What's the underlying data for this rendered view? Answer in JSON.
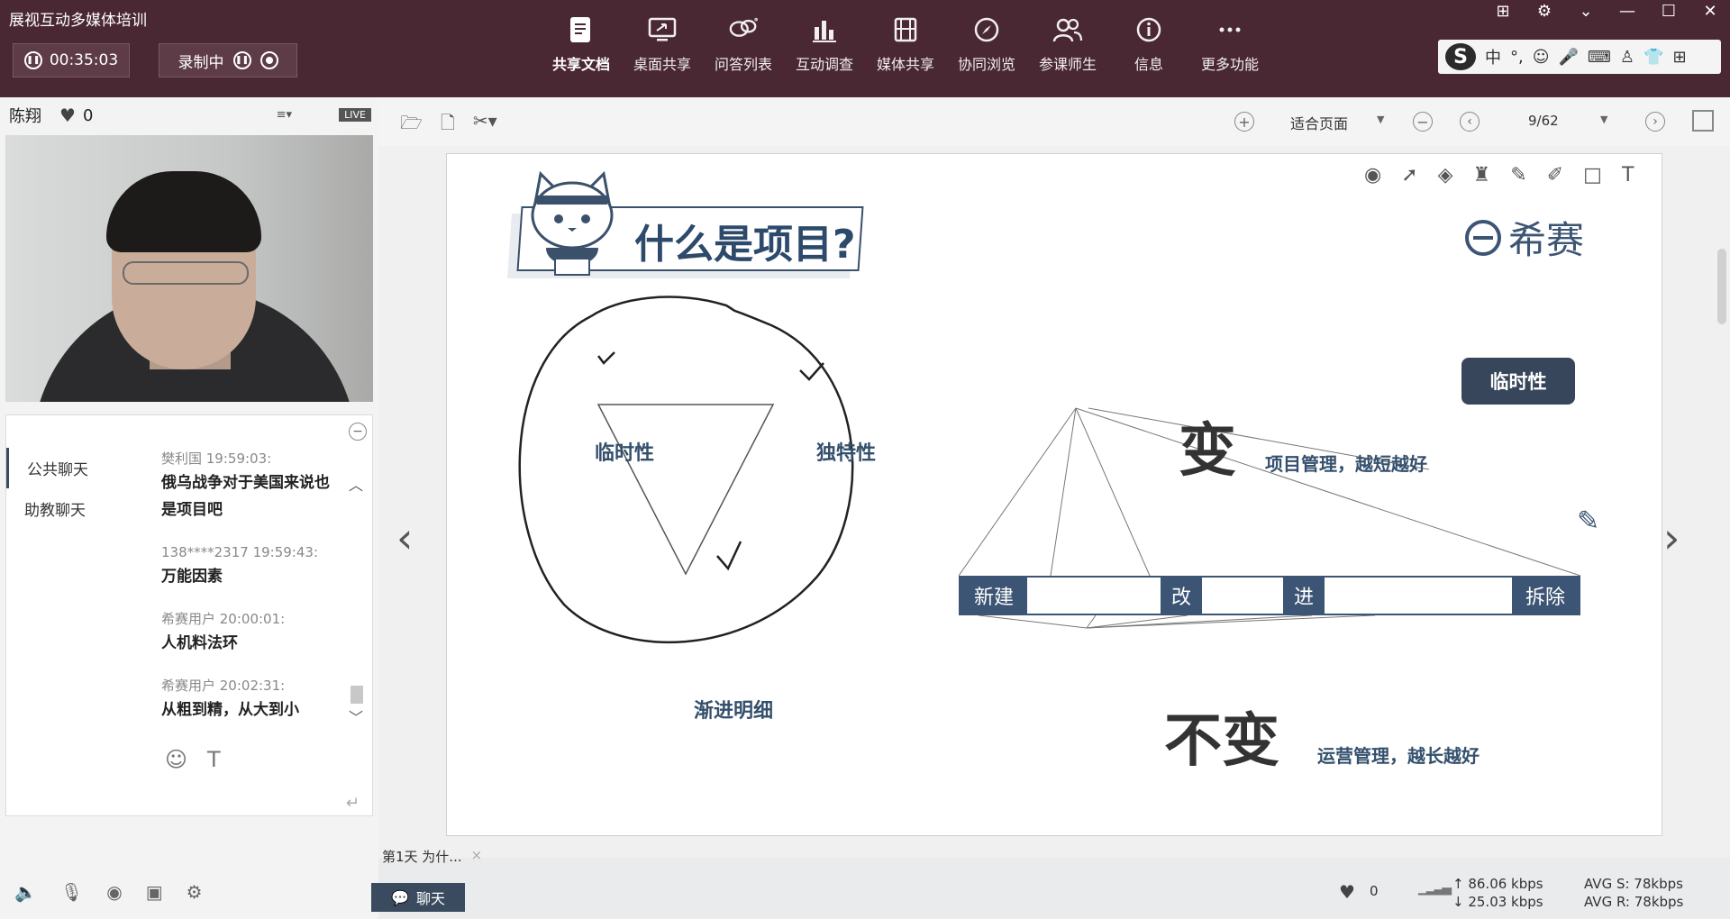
{
  "app": {
    "title": "展视互动多媒体培训",
    "timer": "00:35:03",
    "recording_label": "录制中"
  },
  "toolbar": [
    {
      "label": "共享文档",
      "icon": "doc-share-icon",
      "active": true
    },
    {
      "label": "桌面共享",
      "icon": "desktop-share-icon"
    },
    {
      "label": "问答列表",
      "icon": "qa-list-icon"
    },
    {
      "label": "互动调查",
      "icon": "survey-chart-icon"
    },
    {
      "label": "媒体共享",
      "icon": "media-film-icon"
    },
    {
      "label": "协同浏览",
      "icon": "compass-icon"
    },
    {
      "label": "参课师生",
      "icon": "users-icon"
    },
    {
      "label": "信息",
      "icon": "info-icon"
    },
    {
      "label": "更多功能",
      "icon": "more-dots-icon"
    }
  ],
  "ime": {
    "logo": "S",
    "mode": "中"
  },
  "presenter": {
    "name": "陈翔",
    "likes": "0",
    "live_badge": "LIVE"
  },
  "chat": {
    "tabs": [
      "公共聊天",
      "助教聊天"
    ],
    "messages": [
      {
        "meta": "樊利国 19:59:03:",
        "text": "俄乌战争对于美国来说也是项目吧"
      },
      {
        "meta": "138****2317 19:59:43:",
        "text": "万能因素"
      },
      {
        "meta": "希赛用户 20:00:01:",
        "text": "人机料法环"
      },
      {
        "meta": "希赛用户 20:02:31:",
        "text": "从粗到精，从大到小"
      }
    ],
    "send_button": "聊天"
  },
  "doc": {
    "fit_label": "适合页面",
    "page": "9/62",
    "tab_label": "第1天 为什...",
    "tab_close": "×"
  },
  "slide": {
    "title": "什么是项目?",
    "brand": "希赛",
    "badge": "临时性",
    "triangle_labels": [
      "临时性",
      "独特性",
      "渐进明细"
    ],
    "change_title": "变",
    "change_sub": "项目管理，越短越好",
    "nochange_title": "不变",
    "nochange_sub": "运营管理，越长越好",
    "bar_segments": [
      "新建",
      "改",
      "进",
      "拆除"
    ]
  },
  "status": {
    "likes": "0",
    "upload": "86.06 kbps",
    "download": "25.03 kbps",
    "avg_s": "AVG S: 78kbps",
    "avg_r": "AVG R: 78kbps"
  }
}
